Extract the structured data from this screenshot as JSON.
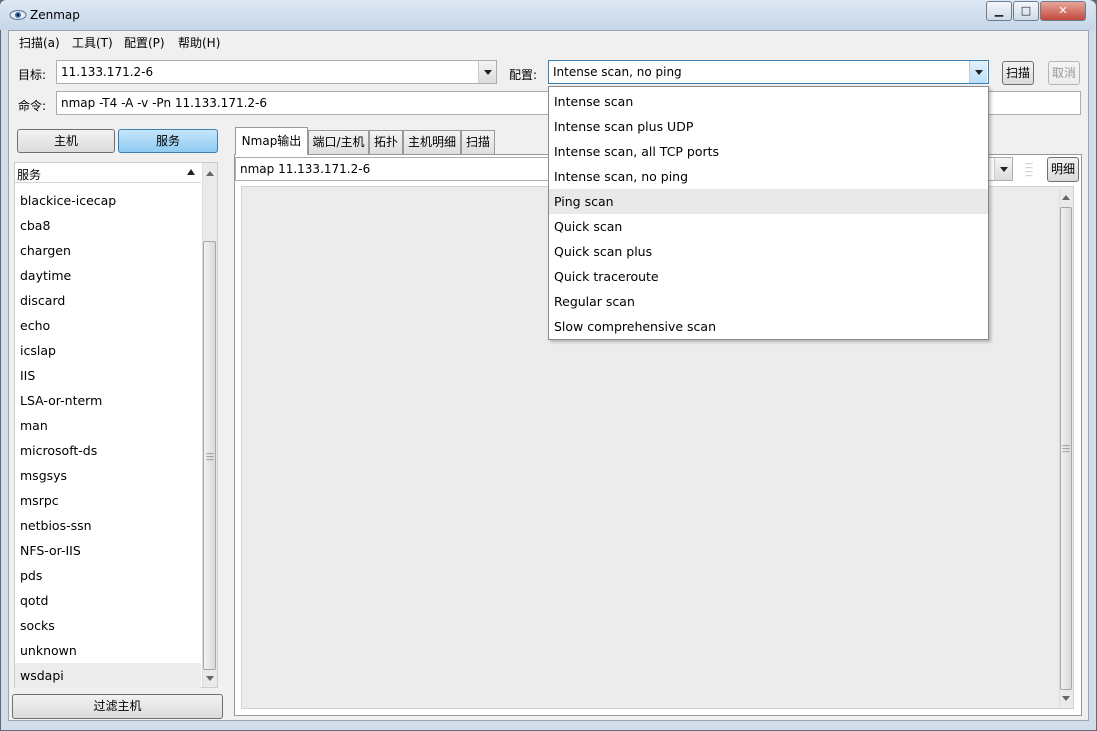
{
  "window": {
    "title": "Zenmap",
    "buttons": {
      "minimize": "▁",
      "maximize": "□",
      "close": "✕"
    }
  },
  "menu": [
    {
      "label": "扫描(a)"
    },
    {
      "label": "工具(T)"
    },
    {
      "label": "配置(P)"
    },
    {
      "label": "帮助(H)"
    }
  ],
  "toolbar": {
    "target_label": "目标:",
    "target_value": "11.133.171.2-6",
    "profile_label": "配置:",
    "profile_value": "Intense scan, no ping",
    "scan_button": "扫描",
    "cancel_button": "取消"
  },
  "command": {
    "label": "命令:",
    "value": "nmap -T4 -A -v -Pn 11.133.171.2-6"
  },
  "left": {
    "hosts_button": "主机",
    "services_button": "服务",
    "list_header": "服务",
    "services": [
      "blackice-icecap",
      "cba8",
      "chargen",
      "daytime",
      "discard",
      "echo",
      "icslap",
      "IIS",
      "LSA-or-nterm",
      "man",
      "microsoft-ds",
      "msgsys",
      "msrpc",
      "netbios-ssn",
      "NFS-or-IIS",
      "pds",
      "qotd",
      "socks",
      "unknown",
      "wsdapi"
    ],
    "filter_button": "过滤主机"
  },
  "tabs": [
    {
      "label": "Nmap输出"
    },
    {
      "label": "端口/主机"
    },
    {
      "label": "拓扑"
    },
    {
      "label": "主机明细"
    },
    {
      "label": "扫描"
    }
  ],
  "output": {
    "selector_value": "nmap 11.133.171.2-6",
    "details_button": "明细"
  },
  "profile_dropdown": {
    "options": [
      "Intense scan",
      "Intense scan plus UDP",
      "Intense scan, all TCP ports",
      "Intense scan, no ping",
      "Ping scan",
      "Quick scan",
      "Quick scan plus",
      "Quick traceroute",
      "Regular scan",
      "Slow comprehensive scan"
    ],
    "highlighted": "Ping scan"
  },
  "colors": {
    "accent": "#8fcaf2",
    "titlebar": "#c6d6e8",
    "close": "#c4493c"
  }
}
